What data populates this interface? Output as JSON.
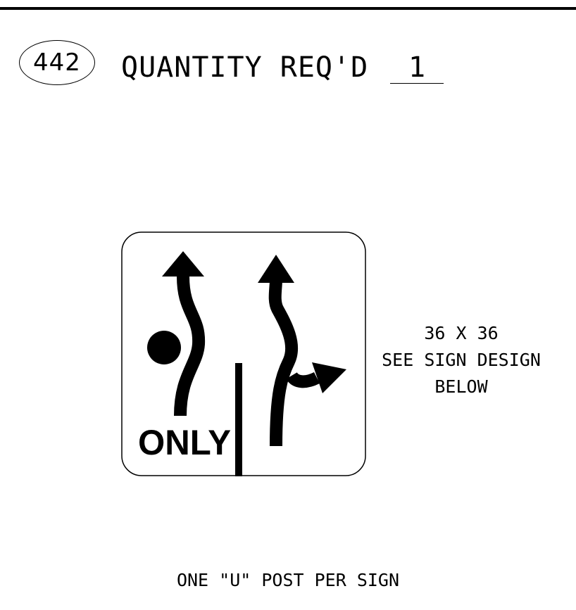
{
  "header": {
    "sign_number": "442",
    "quantity_label": "QUANTITY REQ'D",
    "quantity_value": "1"
  },
  "sign": {
    "legend": "ONLY",
    "symbols": [
      "curved-through-arrow-icon",
      "dot-icon",
      "through-right-split-arrow-icon",
      "lane-divider-line"
    ],
    "colors": {
      "background": "#ffffff",
      "legend": "#000000"
    }
  },
  "sign_note": {
    "size": "36 X 36",
    "line2": "SEE SIGN DESIGN",
    "line3": "BELOW"
  },
  "footer": {
    "post_note": "ONE \"U\" POST PER SIGN"
  }
}
